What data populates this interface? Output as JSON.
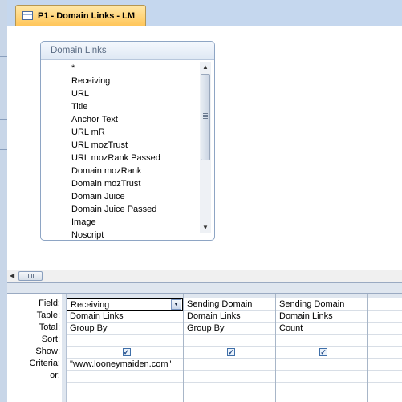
{
  "tab": {
    "title": "P1 - Domain Links - LM",
    "icon": "query-icon"
  },
  "field_list": {
    "title": "Domain Links",
    "fields": [
      "*",
      "Receiving",
      "URL",
      "Title",
      "Anchor Text",
      "URL mR",
      "URL mozTrust",
      "URL mozRank Passed",
      "Domain mozRank",
      "Domain mozTrust",
      "Domain Juice",
      "Domain Juice Passed",
      "Image",
      "Noscript"
    ]
  },
  "grid": {
    "row_labels": [
      "Field:",
      "Table:",
      "Total:",
      "Sort:",
      "Show:",
      "Criteria:",
      "or:"
    ],
    "columns": [
      {
        "field": "Receiving",
        "table": "Domain Links",
        "total": "Group By",
        "sort": "",
        "show": true,
        "criteria": "\"www.looneymaiden.com\"",
        "or": ""
      },
      {
        "field": "Sending Domain",
        "table": "Domain Links",
        "total": "Group By",
        "sort": "",
        "show": true,
        "criteria": "",
        "or": ""
      },
      {
        "field": "Sending Domain",
        "table": "Domain Links",
        "total": "Count",
        "sort": "",
        "show": true,
        "criteria": "",
        "or": ""
      }
    ]
  },
  "colors": {
    "tab_active": "#ffc65a",
    "chrome": "#c5d7ee"
  }
}
